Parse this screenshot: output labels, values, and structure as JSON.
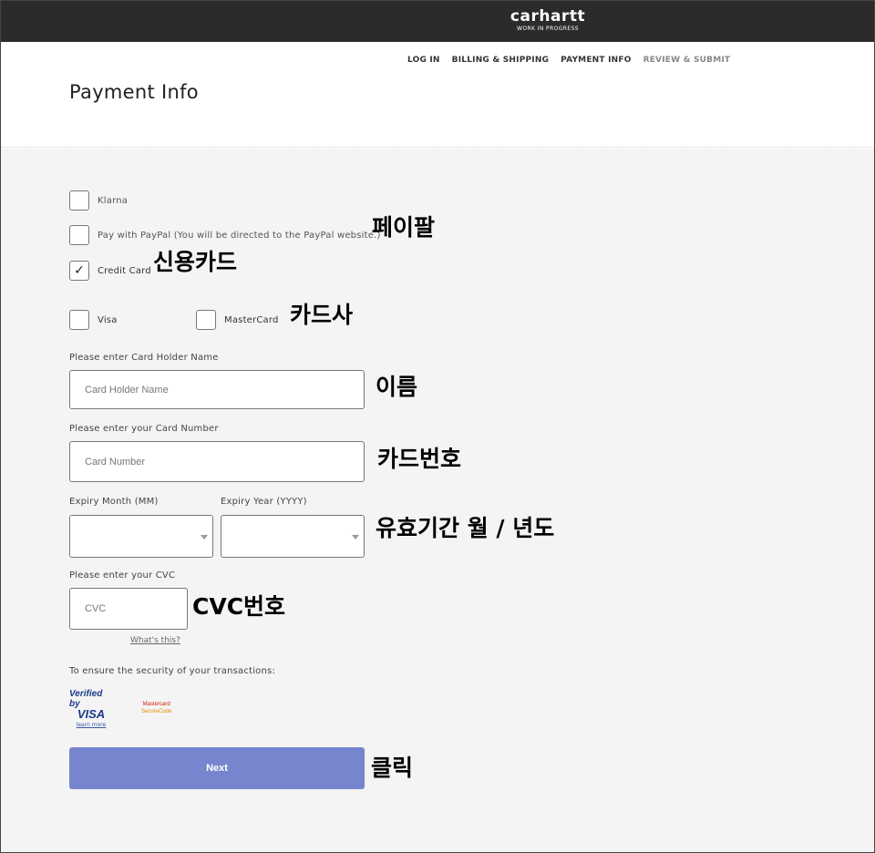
{
  "brand": {
    "name": "carhartt",
    "tagline": "WORK IN PROGRESS"
  },
  "steps": [
    "LOG IN",
    "BILLING & SHIPPING",
    "PAYMENT INFO",
    "REVIEW & SUBMIT"
  ],
  "page_title": "Payment Info",
  "payment_methods": {
    "klarna": {
      "label": "Klarna",
      "checked": false
    },
    "paypal": {
      "label": "Pay with PayPal (You will be directed to the PayPal website.)",
      "checked": false
    },
    "credit_card": {
      "label": "Credit Card",
      "checked": true,
      "check_glyph": "✓"
    }
  },
  "card_types": {
    "visa": {
      "label": "Visa",
      "checked": false
    },
    "mastercard": {
      "label": "MasterCard",
      "checked": false
    }
  },
  "form": {
    "holder_label": "Please enter Card Holder Name",
    "holder_placeholder": "Card Holder Name",
    "number_label": "Please enter your Card Number",
    "number_placeholder": "Card Number",
    "month_label": "Expiry Month (MM)",
    "year_label": "Expiry Year (YYYY)",
    "cvc_label": "Please enter your CVC",
    "cvc_placeholder": "CVC",
    "cvc_help": "What's this?"
  },
  "security": {
    "text": "To ensure the security of your transactions:",
    "vbv_top": "Verified by",
    "vbv_visa": "VISA",
    "vbv_learn": "learn more",
    "mc_line1": "Mastercard",
    "mc_line2": "SecureCode"
  },
  "next_button": "Next",
  "annotations": {
    "paypal": "페이팔",
    "credit_card": "신용카드",
    "card_company": "카드사",
    "name": "이름",
    "card_number": "카드번호",
    "expiry": "유효기간 월 / 년도",
    "cvc": "CVC번호",
    "click": "클릭"
  },
  "colors": {
    "topbar": "#2b2b2b",
    "button": "#7685cd",
    "background": "#f4f4f4"
  }
}
